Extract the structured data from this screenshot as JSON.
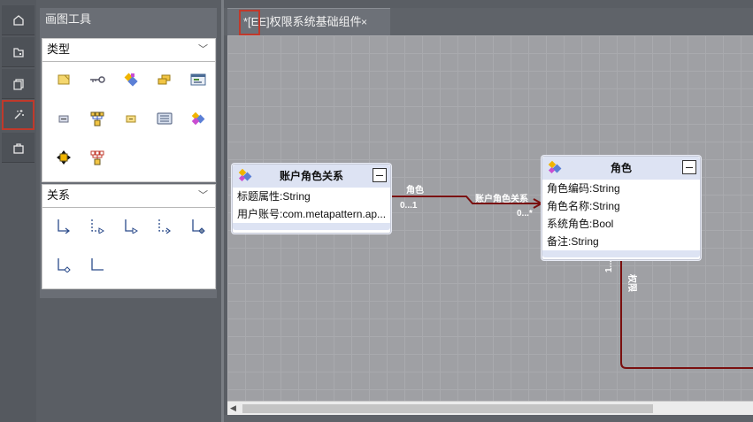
{
  "rail": {
    "items": [
      {
        "icon": "home-icon"
      },
      {
        "icon": "folder-icon"
      },
      {
        "icon": "copy-icon"
      },
      {
        "icon": "magic-icon",
        "active": true
      },
      {
        "icon": "bag-icon"
      }
    ]
  },
  "panel": {
    "title": "画图工具",
    "sections": [
      {
        "label": "类型",
        "tools": [
          "note-tool-icon",
          "key-tool-icon",
          "entity-tool-icon",
          "multi-entity-tool-icon",
          "form-tool-icon",
          "field-tool-icon",
          "tree-tool-icon",
          "enum-tool-icon",
          "list-tool-icon",
          "diamond-entity-tool-icon",
          "move-tool-icon",
          "tree-alt-tool-icon"
        ]
      },
      {
        "label": "关系",
        "tools": [
          "relation-solid-arrow-icon",
          "relation-dashed-triangle-icon",
          "relation-triangle-icon",
          "relation-dashed-arrow-icon",
          "relation-diamond-icon",
          "relation-hollow-diamond-icon",
          "relation-corner-icon"
        ]
      }
    ]
  },
  "editor": {
    "tab_label": "*[EE]权限系统基础组件",
    "tab_close": "×"
  },
  "diagram": {
    "entities": [
      {
        "title": "账户角色关系",
        "attrs": [
          "标题属性:String",
          "用户账号:com.metapattern.ap..."
        ]
      },
      {
        "title": "角色",
        "attrs": [
          "角色编码:String",
          "角色名称:String",
          "系统角色:Bool",
          "备注:String"
        ]
      }
    ],
    "labels": {
      "role_link": "角色",
      "role_mult": "0...1",
      "assoc_link": "账户角色关系",
      "assoc_mult": "0...*",
      "perm_mult": "1...*",
      "perm_link": "权限"
    },
    "connector_color": "#7a0f0f"
  },
  "colors": {
    "accent_highlight": "#c0392b",
    "entity_header": "#dde3f3"
  }
}
